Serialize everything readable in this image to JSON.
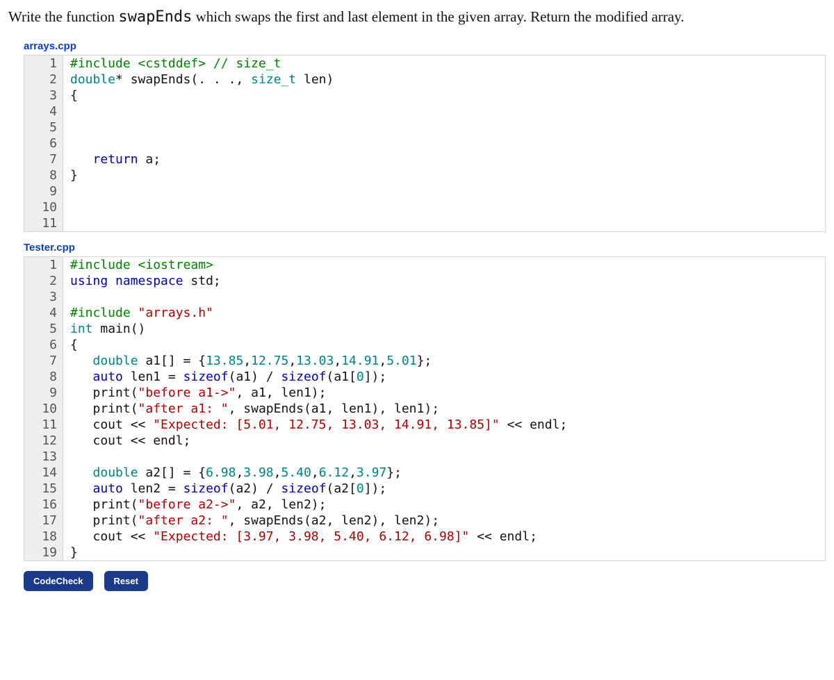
{
  "prompt": {
    "pre": "Write the function ",
    "fn": "swapEnds",
    "post": " which swaps the first and last element in the given array. Return the modified array."
  },
  "files": {
    "arrays_name": "arrays.cpp",
    "tester_name": "Tester.cpp"
  },
  "arrays": {
    "l1a": "#include ",
    "l1b": "<cstddef>",
    "l1c": " // size_t",
    "l2a": "double",
    "l2b": "* swapEnds(. . ., ",
    "l2c": "size_t",
    "l2d": " len)",
    "l3": "{",
    "l7a": "   ",
    "l7b": "return",
    "l7c": " a;",
    "l8": "}"
  },
  "tester": {
    "l1a": "#include ",
    "l1b": "<iostream>",
    "l2a": "using",
    "l2b": " ",
    "l2c": "namespace",
    "l2d": " std;",
    "l4a": "#include ",
    "l4b": "\"arrays.h\"",
    "l5a": "int",
    "l5b": " main()",
    "l6": "{",
    "l7a": "   ",
    "l7b": "double",
    "l7c": " a1[] = {",
    "l7d": "13.85",
    "l7e": ",",
    "l7f": "12.75",
    "l7g": ",",
    "l7h": "13.03",
    "l7i": ",",
    "l7j": "14.91",
    "l7k": ",",
    "l7l": "5.01",
    "l7m": "};",
    "l8a": "   ",
    "l8b": "auto",
    "l8c": " len1 = ",
    "l8d": "sizeof",
    "l8e": "(a1) / ",
    "l8f": "sizeof",
    "l8g": "(a1[",
    "l8h": "0",
    "l8i": "]);",
    "l9a": "   print(",
    "l9b": "\"before a1->\"",
    "l9c": ", a1, len1);",
    "l10a": "   print(",
    "l10b": "\"after a1: \"",
    "l10c": ", swapEnds(a1, len1), len1);",
    "l11a": "   cout << ",
    "l11b": "\"Expected: [5.01, 12.75, 13.03, 14.91, 13.85]\"",
    "l11c": " << endl;",
    "l12": "   cout << endl;",
    "l14a": "   ",
    "l14b": "double",
    "l14c": " a2[] = {",
    "l14d": "6.98",
    "l14e": ",",
    "l14f": "3.98",
    "l14g": ",",
    "l14h": "5.40",
    "l14i": ",",
    "l14j": "6.12",
    "l14k": ",",
    "l14l": "3.97",
    "l14m": "};",
    "l15a": "   ",
    "l15b": "auto",
    "l15c": " len2 = ",
    "l15d": "sizeof",
    "l15e": "(a2) / ",
    "l15f": "sizeof",
    "l15g": "(a2[",
    "l15h": "0",
    "l15i": "]);",
    "l16a": "   print(",
    "l16b": "\"before a2->\"",
    "l16c": ", a2, len2);",
    "l17a": "   print(",
    "l17b": "\"after a2: \"",
    "l17c": ", swapEnds(a2, len2), len2);",
    "l18a": "   cout << ",
    "l18b": "\"Expected: [3.97, 3.98, 5.40, 6.12, 6.98]\"",
    "l18c": " << endl;",
    "l19": "}"
  },
  "buttons": {
    "codecheck": "CodeCheck",
    "reset": "Reset"
  },
  "line_numbers": {
    "arrays": [
      "1",
      "2",
      "3",
      "4",
      "5",
      "6",
      "7",
      "8",
      "9",
      "10",
      "11"
    ],
    "tester": [
      "1",
      "2",
      "3",
      "4",
      "5",
      "6",
      "7",
      "8",
      "9",
      "10",
      "11",
      "12",
      "13",
      "14",
      "15",
      "16",
      "17",
      "18",
      "19"
    ]
  }
}
